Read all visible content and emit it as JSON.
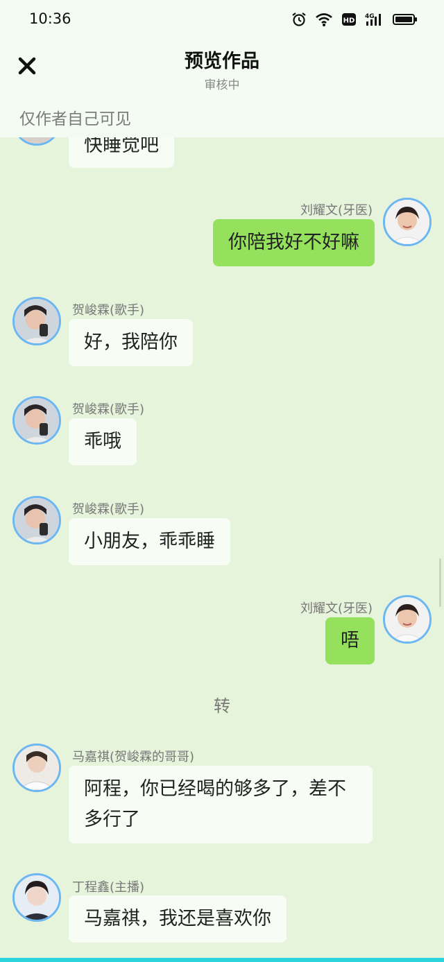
{
  "status_bar": {
    "time": "10:36"
  },
  "header": {
    "title": "预览作品",
    "subtitle": "审核中",
    "visibility_note": "仅作者自己可见"
  },
  "messages": [
    {
      "side": "left",
      "name": "",
      "text": "快睡觉吧"
    },
    {
      "side": "right",
      "name": "刘耀文(牙医)",
      "text": "你陪我好不好嘛"
    },
    {
      "side": "left",
      "name": "贺峻霖(歌手)",
      "text": "好，我陪你"
    },
    {
      "side": "left",
      "name": "贺峻霖(歌手)",
      "text": "乖哦"
    },
    {
      "side": "left",
      "name": "贺峻霖(歌手)",
      "text": "小朋友，乖乖睡"
    },
    {
      "side": "right",
      "name": "刘耀文(牙医)",
      "text": "唔"
    },
    {
      "side": "left",
      "name": "马嘉祺(贺峻霖的哥哥)",
      "text": "阿程，你已经喝的够多了，差不多行了"
    },
    {
      "side": "left",
      "name": "丁程鑫(主播)",
      "text": "马嘉祺，我还是喜欢你"
    }
  ],
  "divider_text": "转",
  "colors": {
    "background": "#e6f4dc",
    "my_bubble": "#95e15e",
    "other_bubble": "#f7fcf5",
    "avatar_ring": "#6cb6f2"
  }
}
